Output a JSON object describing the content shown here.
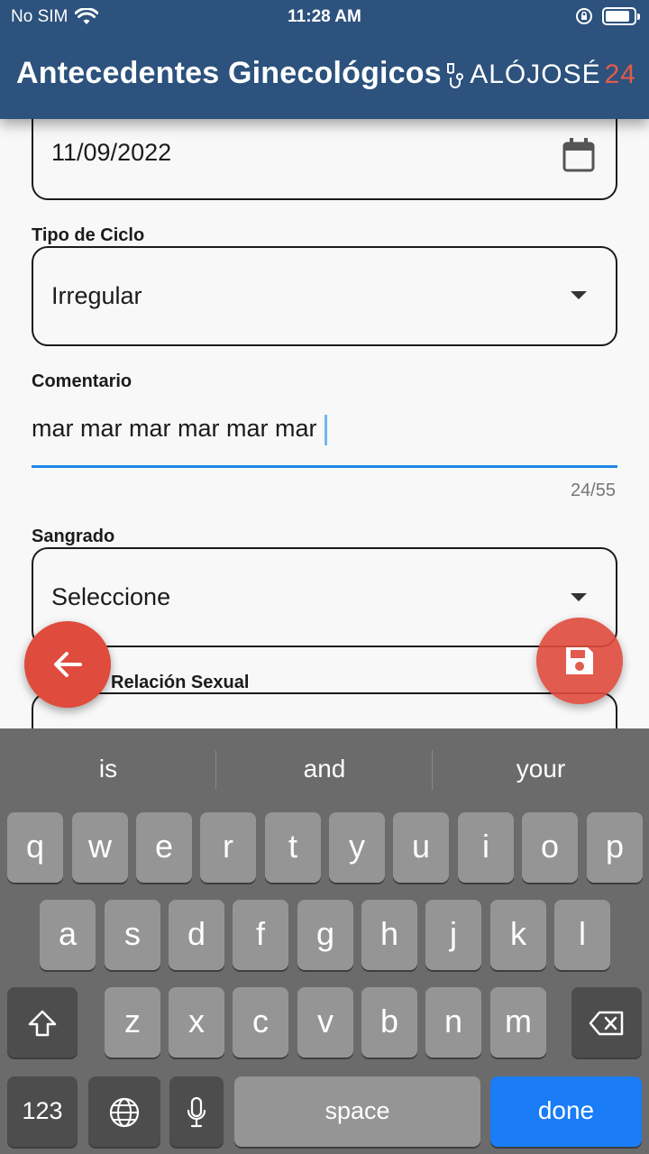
{
  "status_bar": {
    "carrier": "No SIM",
    "time": "11:28 AM"
  },
  "header": {
    "title": "Antecedentes Ginecológicos",
    "logo_text": "ALÓJOSÉ",
    "logo_number": "24",
    "background": "#2c527d"
  },
  "form": {
    "date_value": "11/09/2022",
    "tipo_ciclo": {
      "label": "Tipo de Ciclo",
      "value": "Irregular"
    },
    "comentario": {
      "label": "Comentario",
      "value": "mar mar mar mar mar mar",
      "counter": "24/55"
    },
    "sangrado": {
      "label": "Sangrado",
      "value": "Seleccione"
    },
    "relacion": {
      "label": "Relación Sexual"
    }
  },
  "accent": "#1e88e5",
  "fab_color": "#df4b3c",
  "keyboard": {
    "suggestions": [
      "is",
      "and",
      "your"
    ],
    "row1": [
      "q",
      "w",
      "e",
      "r",
      "t",
      "y",
      "u",
      "i",
      "o",
      "p"
    ],
    "row2": [
      "a",
      "s",
      "d",
      "f",
      "g",
      "h",
      "j",
      "k",
      "l"
    ],
    "row3": [
      "z",
      "x",
      "c",
      "v",
      "b",
      "n",
      "m"
    ],
    "numbers_label": "123",
    "space_label": "space",
    "done_label": "done"
  }
}
